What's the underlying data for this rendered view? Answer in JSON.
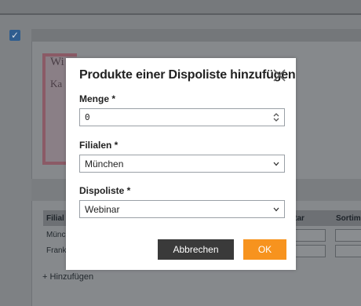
{
  "modal": {
    "title": "Produkte einer Dispoliste hinzufügen",
    "close_icon": "close-icon",
    "menge": {
      "label": "Menge *",
      "value": "0"
    },
    "filialen": {
      "label": "Filialen *",
      "value": "München"
    },
    "dispoliste": {
      "label": "Dispoliste *",
      "value": "Webinar"
    },
    "cancel_label": "Abbrechen",
    "ok_label": "OK"
  },
  "background": {
    "book_title": "Wi",
    "book_subtitle": "Ka",
    "table_headers": [
      "Filial",
      "ntar",
      "Sortim"
    ],
    "rows": [
      "Münch",
      "Frankf"
    ],
    "add_label": "Hinzufügen"
  },
  "colors": {
    "ok": "#f7931e",
    "cancel": "#3a3a3a",
    "overlay": "#7e8184"
  }
}
